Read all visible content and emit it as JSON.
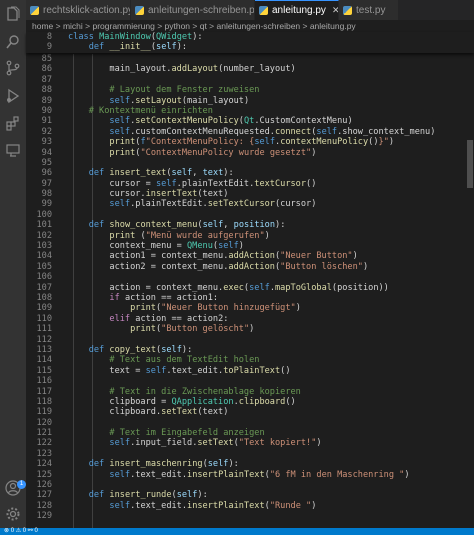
{
  "tabs": [
    {
      "label": "rechtsklick-action.py",
      "active": false
    },
    {
      "label": "anleitungen-schreiben.py",
      "active": false
    },
    {
      "label": "anleitung.py",
      "active": true
    },
    {
      "label": "test.py",
      "active": false
    }
  ],
  "breadcrumb": "home > michi > programmierung > python > qt > anleitungen-schreiben > anleitung.py",
  "status_text": "⊗ 0 ⚠ 0  ⚯ 0",
  "sticky_lines": [
    {
      "num": "8",
      "html": "<span class=\"k\">class</span> <span class=\"t\">MainWindow</span>(<span class=\"t\">QWidget</span>):"
    },
    {
      "num": "9",
      "html": "    <span class=\"k\">def</span> <span class=\"f\">__init__</span>(<span class=\"v\">self</span>):"
    }
  ],
  "code_lines": [
    {
      "num": "85",
      "html": ""
    },
    {
      "num": "86",
      "html": "        main_layout.<span class=\"f\">addLayout</span>(number_layout)"
    },
    {
      "num": "87",
      "html": ""
    },
    {
      "num": "88",
      "html": "        <span class=\"cm\"># Layout dem Fenster zuweisen</span>"
    },
    {
      "num": "89",
      "html": "        <span class=\"k\">self</span>.<span class=\"f\">setLayout</span>(main_layout)"
    },
    {
      "num": "90",
      "html": "    <span class=\"cm\"># Kontextmenü einrichten</span>"
    },
    {
      "num": "91",
      "html": "        <span class=\"k\">self</span>.<span class=\"f\">setContextMenuPolicy</span>(<span class=\"t\">Qt</span>.CustomContextMenu)"
    },
    {
      "num": "92",
      "html": "        <span class=\"k\">self</span>.customContextMenuRequested.<span class=\"f\">connect</span>(<span class=\"k\">self</span>.show_context_menu)"
    },
    {
      "num": "93",
      "html": "        <span class=\"f\">print</span>(<span class=\"k\">f</span><span class=\"s\">\"ContextMenuPolicy: {</span><span class=\"k\">self</span>.<span class=\"f\">contextMenuPolicy</span>()<span class=\"s\">}\"</span>)"
    },
    {
      "num": "94",
      "html": "        <span class=\"f\">print</span>(<span class=\"s\">\"ContextMenuPolicy wurde gesetzt\"</span>)"
    },
    {
      "num": "95",
      "html": ""
    },
    {
      "num": "96",
      "html": "    <span class=\"k\">def</span> <span class=\"f\">insert_text</span>(<span class=\"v\">self</span>, <span class=\"v\">text</span>):"
    },
    {
      "num": "97",
      "html": "        cursor = <span class=\"k\">self</span>.plainTextEdit.<span class=\"f\">textCursor</span>()"
    },
    {
      "num": "98",
      "html": "        cursor.<span class=\"f\">insertText</span>(text)"
    },
    {
      "num": "99",
      "html": "        <span class=\"k\">self</span>.plainTextEdit.<span class=\"f\">setTextCursor</span>(cursor)"
    },
    {
      "num": "100",
      "html": ""
    },
    {
      "num": "101",
      "html": "    <span class=\"k\">def</span> <span class=\"f\">show_context_menu</span>(<span class=\"v\">self</span>, <span class=\"v\">position</span>):"
    },
    {
      "num": "102",
      "html": "        <span class=\"f\">print</span> (<span class=\"s\">\"Menü wurde aufgerufen\"</span>)"
    },
    {
      "num": "103",
      "html": "        context_menu = <span class=\"t\">QMenu</span>(<span class=\"k\">self</span>)"
    },
    {
      "num": "104",
      "html": "        action1 = context_menu.<span class=\"f\">addAction</span>(<span class=\"s\">\"Neuer Button\"</span>)"
    },
    {
      "num": "105",
      "html": "        action2 = context_menu.<span class=\"f\">addAction</span>(<span class=\"s\">\"Button löschen\"</span>)"
    },
    {
      "num": "106",
      "html": ""
    },
    {
      "num": "107",
      "html": "        action = context_menu.<span class=\"f\">exec</span>(<span class=\"k\">self</span>.<span class=\"f\">mapToGlobal</span>(position))"
    },
    {
      "num": "108",
      "html": "        <span class=\"c\">if</span> action == action1:"
    },
    {
      "num": "109",
      "html": "            <span class=\"f\">print</span>(<span class=\"s\">\"Neuer Button hinzugefügt\"</span>)"
    },
    {
      "num": "110",
      "html": "        <span class=\"c\">elif</span> action == action2:"
    },
    {
      "num": "111",
      "html": "            <span class=\"f\">print</span>(<span class=\"s\">\"Button gelöscht\"</span>)"
    },
    {
      "num": "112",
      "html": ""
    },
    {
      "num": "113",
      "html": "    <span class=\"k\">def</span> <span class=\"f\">copy_text</span>(<span class=\"v\">self</span>):"
    },
    {
      "num": "114",
      "html": "        <span class=\"cm\"># Text aus dem TextEdit holen</span>"
    },
    {
      "num": "115",
      "html": "        text = <span class=\"k\">self</span>.text_edit.<span class=\"f\">toPlainText</span>()"
    },
    {
      "num": "116",
      "html": ""
    },
    {
      "num": "117",
      "html": "        <span class=\"cm\"># Text in die Zwischenablage kopieren</span>"
    },
    {
      "num": "118",
      "html": "        clipboard = <span class=\"t\">QApplication</span>.<span class=\"f\">clipboard</span>()"
    },
    {
      "num": "119",
      "html": "        clipboard.<span class=\"f\">setText</span>(text)"
    },
    {
      "num": "120",
      "html": ""
    },
    {
      "num": "121",
      "html": "        <span class=\"cm\"># Text im Eingabefeld anzeigen</span>"
    },
    {
      "num": "122",
      "html": "        <span class=\"k\">self</span>.input_field.<span class=\"f\">setText</span>(<span class=\"s\">\"Text kopiert!\"</span>)"
    },
    {
      "num": "123",
      "html": ""
    },
    {
      "num": "124",
      "html": "    <span class=\"k\">def</span> <span class=\"f\">insert_maschenring</span>(<span class=\"v\">self</span>):"
    },
    {
      "num": "125",
      "html": "        <span class=\"k\">self</span>.text_edit.<span class=\"f\">insertPlainText</span>(<span class=\"s\">\"6 fM in den Maschenring \"</span>)"
    },
    {
      "num": "126",
      "html": ""
    },
    {
      "num": "127",
      "html": "    <span class=\"k\">def</span> <span class=\"f\">insert_runde</span>(<span class=\"v\">self</span>):"
    },
    {
      "num": "128",
      "html": "        <span class=\"k\">self</span>.text_edit.<span class=\"f\">insertPlainText</span>(<span class=\"s\">\"Runde \"</span>)"
    },
    {
      "num": "129",
      "html": ""
    }
  ],
  "icons": [
    "explorer-icon",
    "search-icon",
    "source-control-icon",
    "run-debug-icon",
    "extensions-icon",
    "remote-icon",
    "account-icon",
    "settings-icon"
  ]
}
